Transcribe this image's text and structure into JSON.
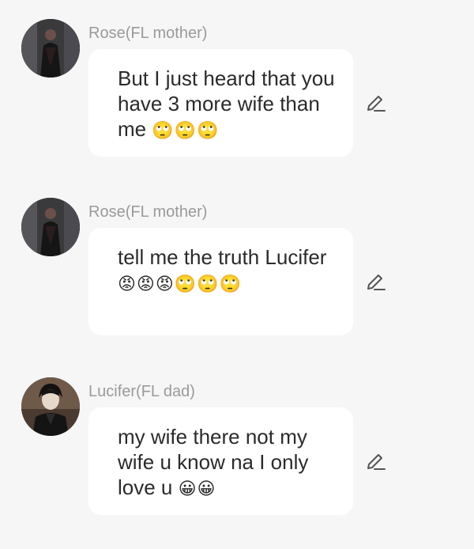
{
  "messages": [
    {
      "sender": "Rose(FL mother)",
      "text": "But I just heard that you have 3 more wife than me",
      "emojis": "🙄🙄🙄",
      "avatar_icon": "dark-figure-avatar"
    },
    {
      "sender": "Rose(FL mother)",
      "text": "tell me the truth Lucifer",
      "emojis": "😡😡😡🙄🙄🙄",
      "avatar_icon": "dark-figure-avatar"
    },
    {
      "sender": "Lucifer(FL dad)",
      "text": "my wife there not my wife u know na I only love u",
      "emojis": "😀😀",
      "avatar_icon": "man-in-suit-avatar"
    }
  ],
  "edit_icon": "pencil-icon",
  "colors": {
    "background": "#f6f6f6",
    "bubble": "#ffffff",
    "name": "#9a9a9a",
    "text": "#2b2b2b"
  }
}
